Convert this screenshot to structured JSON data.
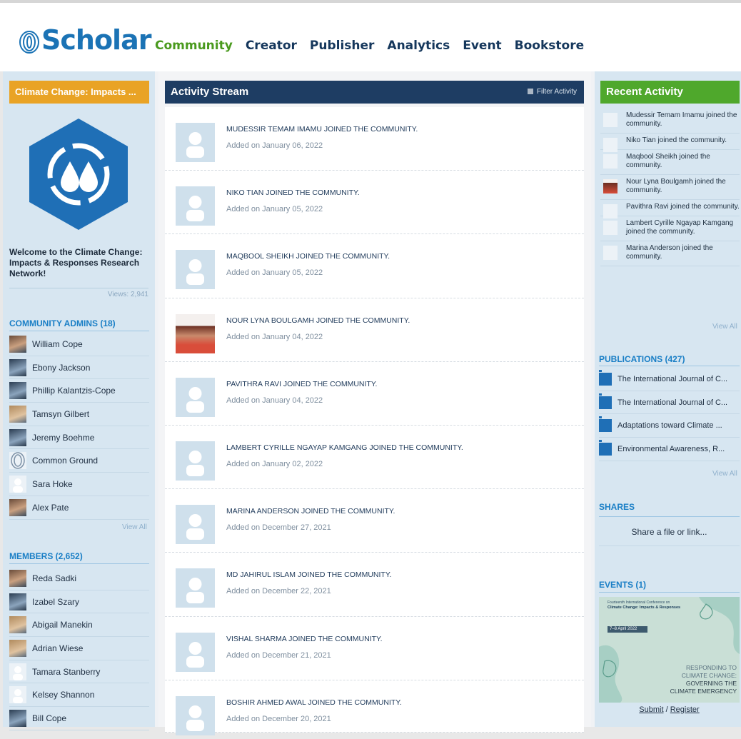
{
  "header": {
    "logo_text": "Scholar",
    "nav": [
      "Community",
      "Creator",
      "Publisher",
      "Analytics",
      "Event",
      "Bookstore"
    ],
    "active_nav": "Community"
  },
  "left": {
    "community_selector": "Climate Change: Impacts ...",
    "welcome": "Welcome to the Climate Change: Impacts & Responses Research Network!",
    "views": "Views: 2,941",
    "admins_title": "COMMUNITY ADMINS (18)",
    "admins": [
      "William Cope",
      "Ebony Jackson",
      "Phillip Kalantzis-Cope",
      "Tamsyn Gilbert",
      "Jeremy Boehme",
      "Common Ground",
      "Sara Hoke",
      "Alex Pate"
    ],
    "admins_view_all": "View All",
    "members_title": "MEMBERS (2,652)",
    "members": [
      "Reda Sadki",
      "Izabel Szary",
      "Abigail Manekin",
      "Adrian Wiese",
      "Tamara Stanberry",
      "Kelsey Shannon",
      "Bill Cope"
    ]
  },
  "stream": {
    "title": "Activity Stream",
    "filter_label": "Filter Activity",
    "items": [
      {
        "text": "MUDESSIR TEMAM IMAMU JOINED THE COMMUNITY.",
        "date": "Added on January 06, 2022"
      },
      {
        "text": "NIKO TIAN JOINED THE COMMUNITY.",
        "date": "Added on January 05, 2022"
      },
      {
        "text": "MAQBOOL SHEIKH JOINED THE COMMUNITY.",
        "date": "Added on January 05, 2022"
      },
      {
        "text": "NOUR LYNA BOULGAMH JOINED THE COMMUNITY.",
        "date": "Added on January 04, 2022"
      },
      {
        "text": "PAVITHRA RAVI JOINED THE COMMUNITY.",
        "date": "Added on January 04, 2022"
      },
      {
        "text": "LAMBERT CYRILLE NGAYAP KAMGANG JOINED THE COMMUNITY.",
        "date": "Added on January 02, 2022"
      },
      {
        "text": "MARINA ANDERSON JOINED THE COMMUNITY.",
        "date": "Added on December 27, 2021"
      },
      {
        "text": "MD JAHIRUL ISLAM JOINED THE COMMUNITY.",
        "date": "Added on December 22, 2021"
      },
      {
        "text": "VISHAL SHARMA JOINED THE COMMUNITY.",
        "date": "Added on December 21, 2021"
      },
      {
        "text": "BOSHIR AHMED AWAL JOINED THE COMMUNITY.",
        "date": "Added on December 20, 2021"
      }
    ]
  },
  "right": {
    "recent_title": "Recent Activity",
    "recent": [
      "Mudessir Temam Imamu joined the community.",
      "Niko Tian joined the community.",
      "Maqbool Sheikh joined the community.",
      "Nour Lyna Boulgamh joined the community.",
      "Pavithra Ravi joined the community.",
      "Lambert Cyrille Ngayap Kamgang joined the community.",
      "Marina Anderson joined the community."
    ],
    "recent_view_all": "View All",
    "publications_title": "PUBLICATIONS (427)",
    "publications": [
      "The International Journal of C...",
      "The International Journal of C...",
      "Adaptations toward Climate ...",
      "Environmental Awareness, R..."
    ],
    "publications_view_all": "View All",
    "shares_title": "SHARES",
    "share_prompt": "Share a file or link...",
    "events_title": "EVENTS (1)",
    "event_banner": {
      "line1": "Fourteenth International Conference on",
      "line2": "Climate Change: Impacts & Responses",
      "date": "7–8 April 2022",
      "tag1": "RESPONDING TO",
      "tag2": "CLIMATE CHANGE:",
      "tag3": "GOVERNING THE",
      "tag4": "CLIMATE EMERGENCY"
    },
    "submit_label": "Submit",
    "separator": "/",
    "register_label": "Register"
  },
  "colors": {
    "brand_blue": "#1b73b5",
    "nav_active": "#4a9a1e",
    "selector_orange": "#e9a325",
    "stream_header": "#1e3d63",
    "recent_green": "#4fa82c",
    "panel_blue": "#d7e6f1"
  }
}
